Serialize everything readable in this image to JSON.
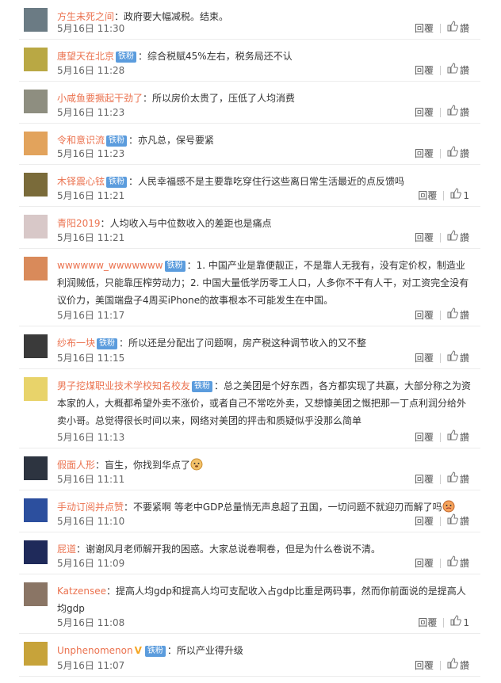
{
  "comments": [
    {
      "user": "方生未死之间",
      "badge": "",
      "sep": "：",
      "text": "政府要大幅减税。结束。",
      "time": "5月16日 11:30",
      "reply": "回覆",
      "like": "讚",
      "avatar_color": "#6b7b84",
      "h": 50
    },
    {
      "user": "唐望天在北京",
      "badge": "铁粉",
      "sep": "：",
      "text": "综合税赋45%左右，税务局还不认",
      "time": "5月16日 11:28",
      "reply": "回覆",
      "like": "讚",
      "avatar_color": "#b9a844",
      "h": 53
    },
    {
      "user": "小咸鱼要撅起干劲了",
      "badge": "",
      "sep": "：",
      "text": "所以房价太贵了，压低了人均消费",
      "time": "5月16日 11:23",
      "reply": "回覆",
      "like": "讚",
      "avatar_color": "#8e8e80",
      "h": 53
    },
    {
      "user": "令和意识流",
      "badge": "铁粉",
      "sep": "：",
      "text": "亦凡总，保号要紧",
      "time": "5月16日 11:23",
      "reply": "回覆",
      "like": "讚",
      "avatar_color": "#e2a35c",
      "h": 52
    },
    {
      "user": "木铎震心铉",
      "badge": "铁粉",
      "sep": "：",
      "text": "人民幸福感不是主要靠吃穿住行这些离日常生活最近的点反馈吗",
      "time": "5月16日 11:21",
      "reply": "回覆",
      "like": "1",
      "avatar_color": "#7a6b3a",
      "h": 53
    },
    {
      "user": "青阳2019",
      "badge": "",
      "sep": "：",
      "text": "人均收入与中位数收入的差距也是痛点",
      "time": "5月16日 11:21",
      "reply": "回覆",
      "like": "讚",
      "avatar_color": "#d8c8c8",
      "h": 53
    },
    {
      "user": "wwwwww_wwwwwww",
      "badge": "铁粉",
      "sep": "：",
      "text": "1. 中国产业是靠便靓正，不是靠人无我有，没有定价权，制造业利润贼低，只能靠压榨劳动力；2. 中国大量低学历零工人口，人多你不干有人干，对工资完全没有议价力，美国端盘子4周买iPhone的故事根本不可能发生在中国。",
      "time": "5月16日 11:17",
      "reply": "回覆",
      "like": "讚",
      "avatar_color": "#d98a5a",
      "h": 98
    },
    {
      "user": "纱布一块",
      "badge": "铁粉",
      "sep": "：",
      "text": "所以还是分配出了问题啊，房产税这种调节收入的又不整",
      "time": "5月16日 11:15",
      "reply": "回覆",
      "like": "讚",
      "avatar_color": "#3a3a3a",
      "h": 54
    },
    {
      "user": "男子挖煤职业技术学校知名校友",
      "badge": "铁粉",
      "sep": "：",
      "text": "总之美团是个好东西，各方都实现了共赢，大部分称之为资本家的人，大概都希望外卖不涨价，或者自己不常吃外卖，又想慷美团之慨把那一丁点利润分给外卖小哥。总觉得很长时间以来，网络对美团的抨击和质疑似乎没那么简单",
      "time": "5月16日 11:13",
      "reply": "回覆",
      "like": "讚",
      "avatar_color": "#e8d36a",
      "h": 100
    },
    {
      "user": "假面人形",
      "badge": "",
      "sep": "：",
      "text": "盲生，你找到华点了",
      "emoji": "doge",
      "time": "5月16日 11:11",
      "reply": "回覆",
      "like": "讚",
      "avatar_color": "#2d3440",
      "h": 53
    },
    {
      "user": "手动订阅并点赞",
      "badge": "",
      "sep": "：",
      "text": "不要紧啊 等老中GDP总量悄无声息超了丑国，一切问题不就迎刃而解了吗",
      "emoji": "face",
      "time": "5月16日 11:10",
      "reply": "回覆",
      "like": "讚",
      "avatar_color": "#2c4f9e",
      "h": 53
    },
    {
      "user": "屁道",
      "badge": "",
      "sep": "：",
      "text": "谢谢风月老师解开我的困惑。大家总说卷啊卷，但是为什么卷说不清。",
      "time": "5月16日 11:09",
      "reply": "回覆",
      "like": "讚",
      "avatar_color": "#1f2a5a",
      "h": 53
    },
    {
      "user": "Katzensee",
      "badge": "",
      "sep": "：",
      "text": "提高人均gdp和提高人均可支配收入占gdp比重是两码事，然而你前面说的是提高人均gdp",
      "time": "5月16日 11:08",
      "reply": "回覆",
      "like": "1",
      "avatar_color": "#8a7565",
      "h": 75
    },
    {
      "user": "Unphenomenon",
      "badge": "铁粉",
      "vip": "V",
      "sep": "：",
      "text": "所以产业得升级",
      "time": "5月16日 11:07",
      "reply": "回覆",
      "like": "讚",
      "avatar_color": "#c7a33a",
      "h": 54
    }
  ]
}
